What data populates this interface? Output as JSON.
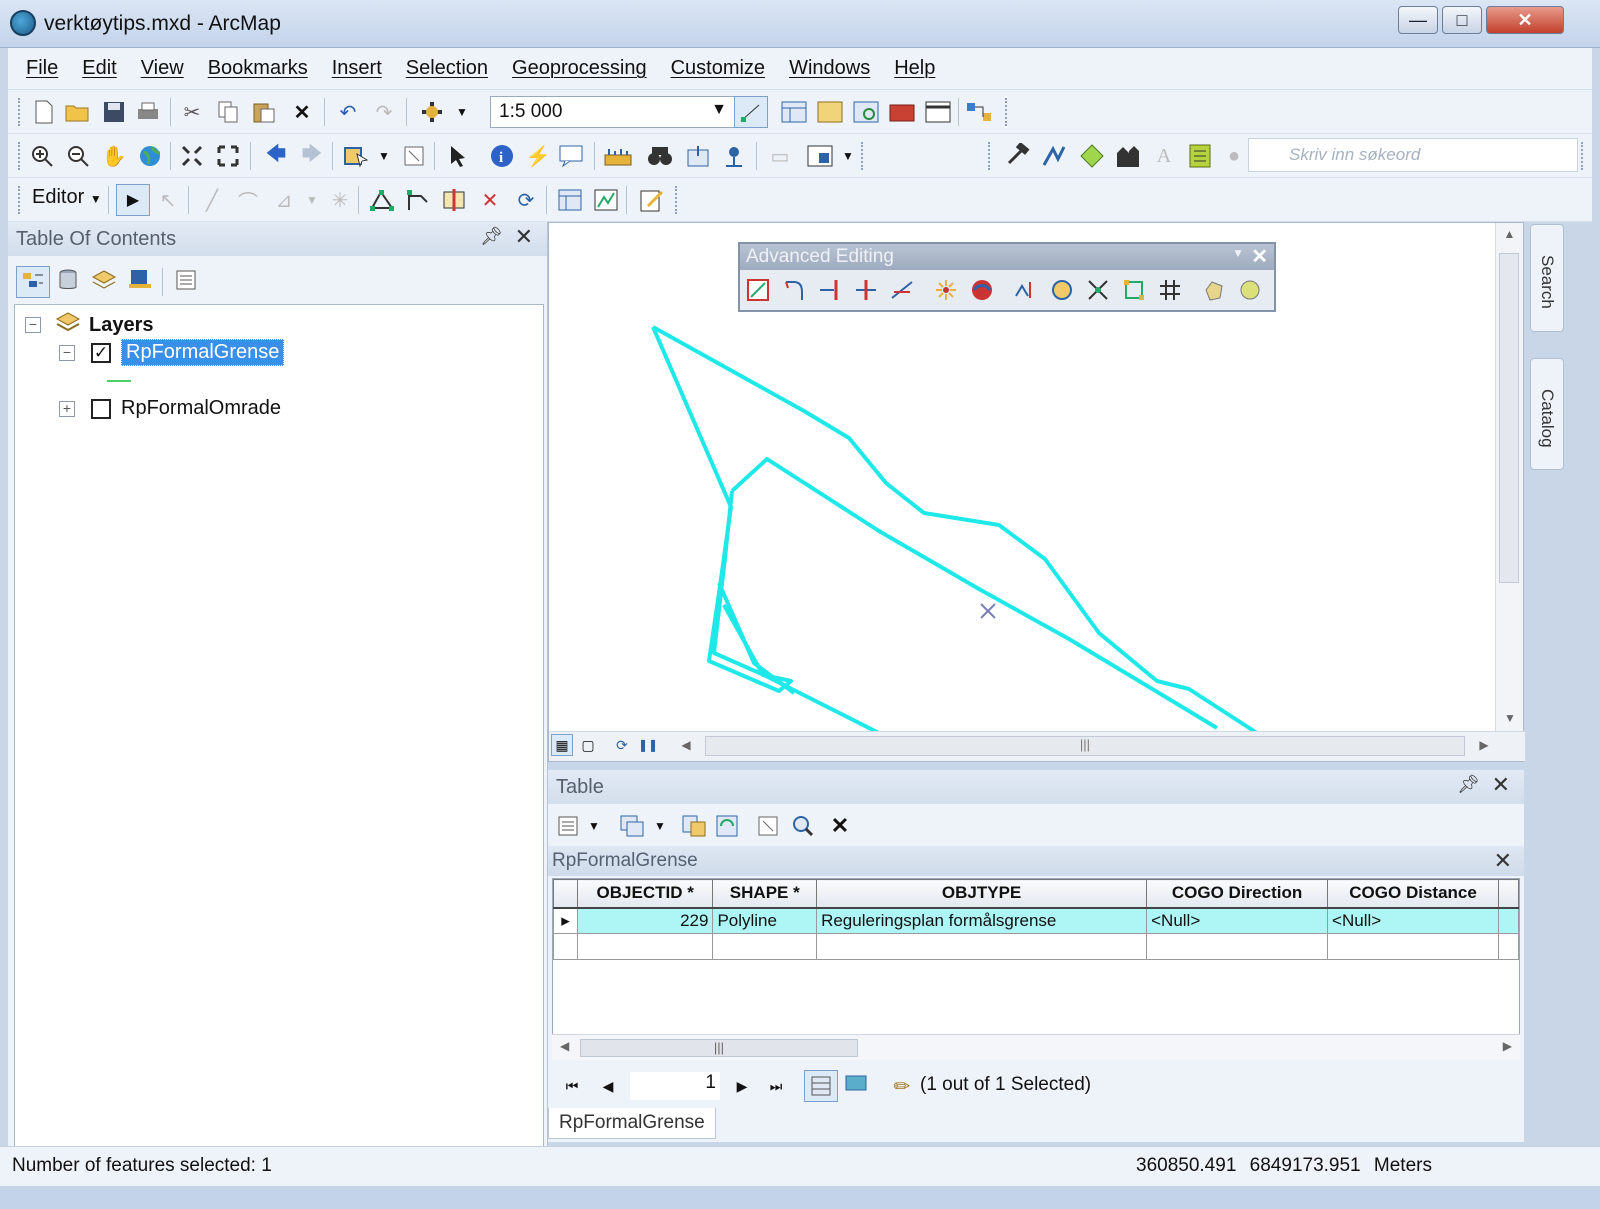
{
  "window": {
    "title": "verktøytips.mxd - ArcMap",
    "minimize": "—",
    "maximize": "□",
    "close": "✕"
  },
  "menu": [
    "File",
    "Edit",
    "View",
    "Bookmarks",
    "Insert",
    "Selection",
    "Geoprocessing",
    "Customize",
    "Windows",
    "Help"
  ],
  "toolbar": {
    "scale": "1:5 000",
    "coordinate_placeholder": "Skriv inn søkeord",
    "editor_label": "Editor"
  },
  "toc": {
    "title": "Table Of Contents",
    "root": "Layers",
    "layers": [
      {
        "name": "RpFormalGrense",
        "checked": true,
        "expanded": true,
        "selected": true
      },
      {
        "name": "RpFormalOmrade",
        "checked": false,
        "expanded": false,
        "selected": false
      }
    ]
  },
  "advanced_editing": {
    "title": "Advanced Editing"
  },
  "side_tabs": [
    "Search",
    "Catalog"
  ],
  "table": {
    "title": "Table",
    "layer_name": "RpFormalGrense",
    "columns": [
      "OBJECTID *",
      "SHAPE *",
      "OBJTYPE",
      "COGO Direction",
      "COGO Distance"
    ],
    "rows": [
      [
        "229",
        "Polyline",
        "Reguleringsplan formålsgrense",
        "<Null>",
        "<Null>"
      ]
    ],
    "record": "1",
    "selection_text": "(1 out of 1 Selected)",
    "tab_label": "RpFormalGrense"
  },
  "status": {
    "left": "Number of features selected: 1",
    "x": "360850.491",
    "y": "6849173.951",
    "units": "Meters"
  },
  "colors": {
    "feature": "#1fe8e8",
    "selected_layer": "#3a8fe8",
    "selected_row": "#aef5f5"
  }
}
